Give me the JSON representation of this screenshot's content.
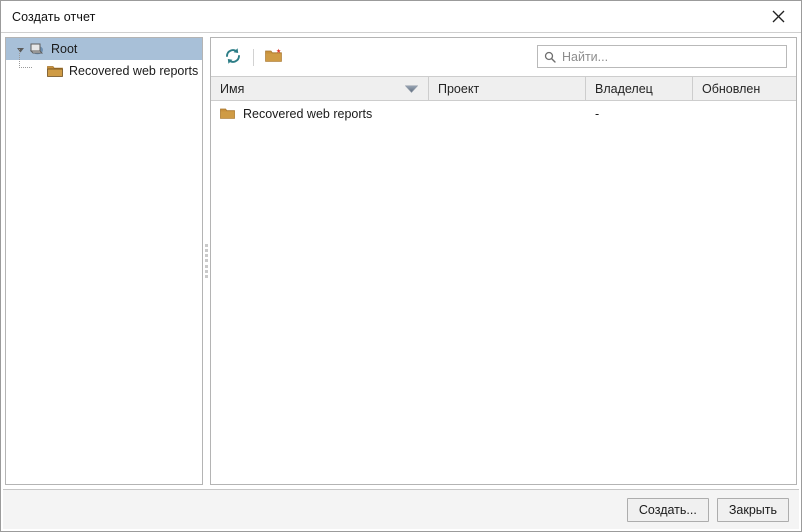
{
  "window": {
    "title": "Создать отчет",
    "close_icon": "close-icon"
  },
  "tree": {
    "items": [
      {
        "label": "Root",
        "icon": "database-icon",
        "selected": true,
        "expanded": true
      },
      {
        "label": "Recovered web reports",
        "icon": "folder-icon",
        "selected": false
      }
    ]
  },
  "toolbar": {
    "refresh_icon": "refresh-icon",
    "new_folder_icon": "new-folder-icon"
  },
  "search": {
    "placeholder": "Найти...",
    "value": "",
    "icon": "search-icon"
  },
  "table": {
    "columns": [
      {
        "label": "Имя",
        "sorted": true,
        "sort_direction": "desc"
      },
      {
        "label": "Проект",
        "sorted": false
      },
      {
        "label": "Владелец",
        "sorted": false
      },
      {
        "label": "Обновлен",
        "sorted": false
      }
    ],
    "rows": [
      {
        "name": "Recovered web reports",
        "icon": "folder-icon",
        "project": "",
        "owner": "-",
        "updated": ""
      }
    ]
  },
  "footer": {
    "create_label": "Создать...",
    "close_label": "Закрыть"
  },
  "colors": {
    "selection": "#a8c0d8",
    "folder": "#c8913c",
    "refresh": "#2c7d86",
    "header_bg": "#efefef",
    "footer_bg": "#f4f4f4"
  }
}
